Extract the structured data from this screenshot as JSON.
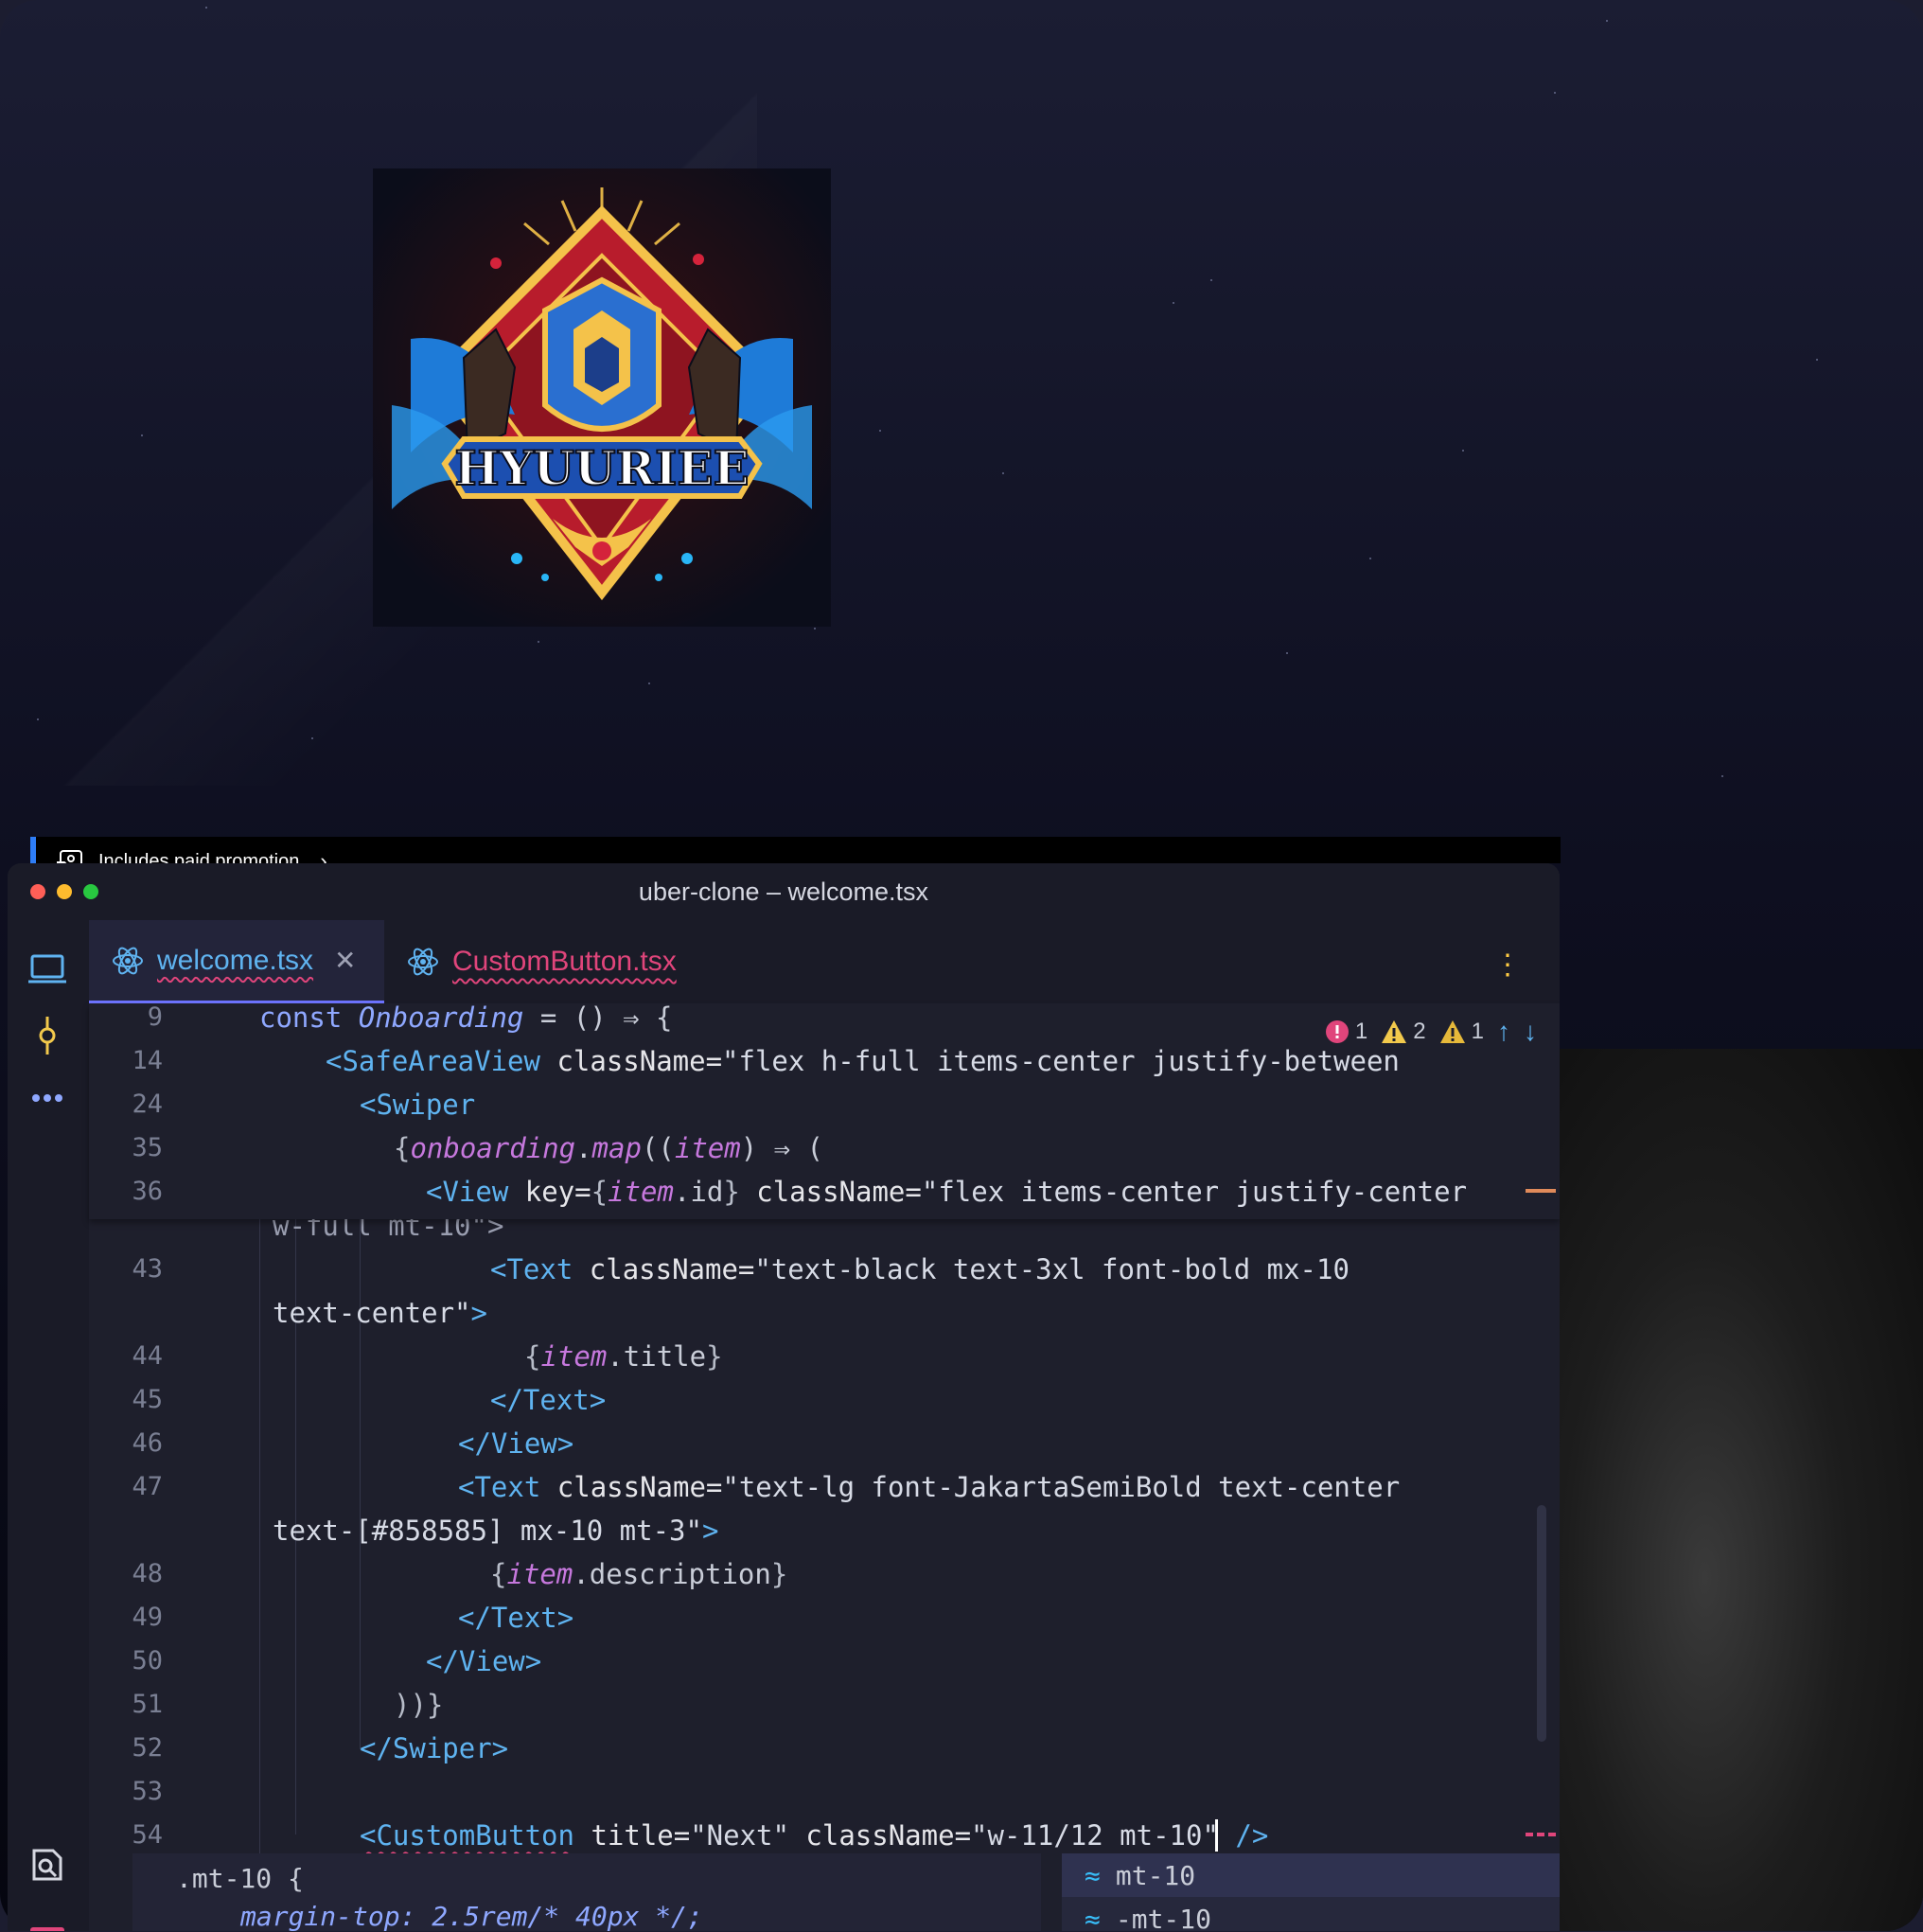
{
  "promo": {
    "label": "Includes paid promotion"
  },
  "logo": {
    "text": "HYUURIEE"
  },
  "window": {
    "title": "uber-clone – welcome.tsx"
  },
  "tabs": [
    {
      "label": "welcome.tsx",
      "active": true
    },
    {
      "label": "CustomButton.tsx",
      "active": false
    }
  ],
  "status": {
    "errors": "1",
    "warnings": "2",
    "weak_warnings": "1"
  },
  "sticky_lines": [
    {
      "num": "9",
      "text": "const Onboarding = () ⇒ {"
    },
    {
      "num": "14",
      "text": "<SafeAreaView className=\"flex h-full items-center justify-between"
    },
    {
      "num": "24",
      "text": "<Swiper"
    },
    {
      "num": "35",
      "text": "{onboarding.map((item) ⇒ ("
    },
    {
      "num": "36",
      "text": "<View key={item.id} className=\"flex items-center justify-center"
    }
  ],
  "code_lines": [
    {
      "num": "",
      "text": "w-full mt-10\">"
    },
    {
      "num": "43",
      "text": "<Text className=\"text-black text-3xl font-bold mx-10"
    },
    {
      "num": "",
      "text": "text-center\">"
    },
    {
      "num": "44",
      "text": "{item.title}"
    },
    {
      "num": "45",
      "text": "</Text>"
    },
    {
      "num": "46",
      "text": "</View>"
    },
    {
      "num": "47",
      "text": "<Text className=\"text-lg font-JakartaSemiBold text-center"
    },
    {
      "num": "",
      "text": "text-[#858585] mx-10 mt-3\">"
    },
    {
      "num": "48",
      "text": "{item.description}"
    },
    {
      "num": "49",
      "text": "</Text>"
    },
    {
      "num": "50",
      "text": "</View>"
    },
    {
      "num": "51",
      "text": "))}"
    },
    {
      "num": "52",
      "text": "</Swiper>"
    },
    {
      "num": "53",
      "text": ""
    },
    {
      "num": "54",
      "text": "<CustomButton title=\"Next\" className=\"w-11/12 mt-10\" />"
    }
  ],
  "doc_popup": {
    "line1": ".mt-10 {",
    "line2": "margin-top: 2.5rem/* 40px */;"
  },
  "suggestions": [
    "mt-10",
    "-mt-10"
  ],
  "colors": {
    "accent": "#6e73ff",
    "error": "#e0457b",
    "warning": "#f2c94c"
  }
}
